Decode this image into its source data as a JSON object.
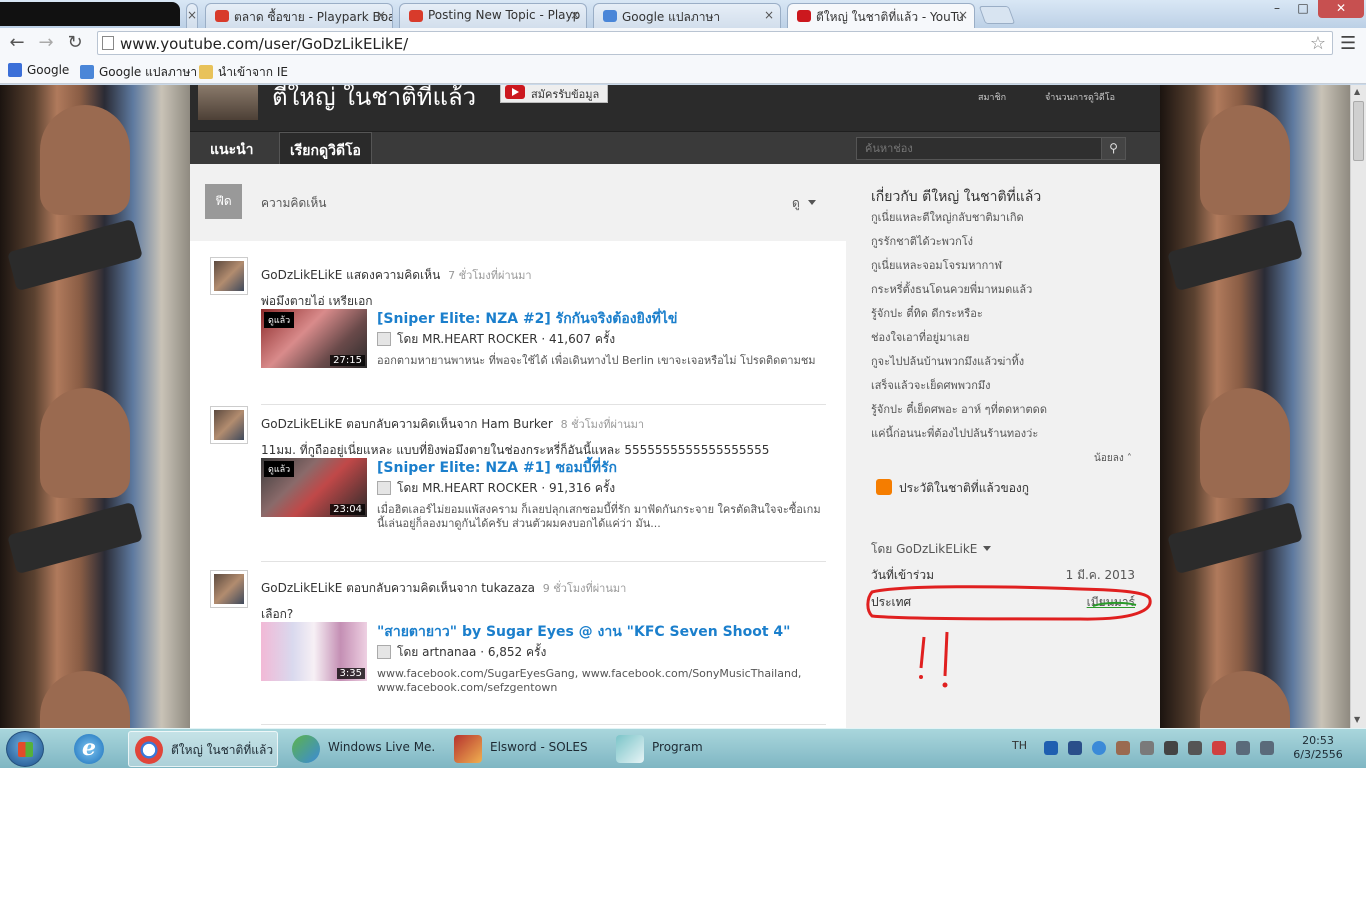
{
  "browser": {
    "tabs": [
      {
        "label": "ตลาด ซื้อขาย - Playpark Boa",
        "favicon_color": "#d83b2b"
      },
      {
        "label": "Posting New Topic - Playp",
        "favicon_color": "#d83b2b"
      },
      {
        "label": "Google แปลภาษา",
        "favicon_color": "#4a86d8"
      },
      {
        "label": "ตีใหญ่ ในชาติที่แล้ว - YouTu",
        "favicon_color": "#cc181e"
      }
    ],
    "tab_close_glyph": "×",
    "window_controls": {
      "minimize": "–",
      "maximize": "□",
      "close": "✕"
    },
    "url": "www.youtube.com/user/GoDzLikELikE/",
    "bookmarks": [
      {
        "label": "Google",
        "icon": "google-icon",
        "color": "#3b6fd8"
      },
      {
        "label": "Google แปลภาษา",
        "icon": "translate-icon",
        "color": "#4a86d8"
      },
      {
        "label": "นำเข้าจาก IE",
        "icon": "folder-icon",
        "color": "#e8c25a"
      }
    ]
  },
  "channel": {
    "title": "ตีใหญ่ ในชาติที่แล้ว",
    "subscribe_label": "สมัครรับข้อมูล",
    "stats": {
      "subscribers_label": "สมาชิก",
      "views_label": "จำนวนการดูวิดีโอ"
    },
    "tabs": [
      {
        "label": "แนะนำ"
      },
      {
        "label": "เรียกดูวิดีโอ"
      }
    ],
    "search_placeholder": "ค้นหาช่อง"
  },
  "feed": {
    "header_badge": "ฟีด",
    "filter_label": "ความคิดเห็น",
    "view_label": "ดู",
    "items": [
      {
        "actor": "GoDzLikELikE",
        "action": "แสดงความคิดเห็น",
        "time": "7 ชั่วโมงที่ผ่านมา",
        "comment": "พ่อมึงตายไอ่ เหรียเอก",
        "video_title": "[Sniper Elite: NZA #2] รักกันจริงต้องยิงที่ไข่",
        "by_prefix": "โดย",
        "uploader": "MR.HEART ROCKER",
        "views": "41,607 ครั้ง",
        "thumb_badge": "ดูแล้ว",
        "duration": "27:15",
        "description": "ออกตามหายานพาหนะ ที่พอจะใช้ได้ เพื่อเดินทางไป Berlin เขาจะเจอหรือไม่ โปรดติดตามชม"
      },
      {
        "actor": "GoDzLikELikE",
        "action": "ตอบกลับความคิดเห็นจาก Ham Burker",
        "time": "8 ชั่วโมงที่ผ่านมา",
        "comment": "11มม. ที่กูถืออยู่เนี่ยแหละ แบบที่ยิงพ่อมึงตายในช่องกระหรี่ก็อันนี้แหละ 5555555555555555555",
        "video_title": "[Sniper Elite: NZA #1] ซอมบี้ที่รัก",
        "by_prefix": "โดย",
        "uploader": "MR.HEART ROCKER",
        "views": "91,316 ครั้ง",
        "thumb_badge": "ดูแล้ว",
        "duration": "23:04",
        "description": "เมื่อฮิตเลอร์ไม่ยอมแพ้สงคราม ก็เลยปลุกเสกซอมบี้ที่รัก มาฟัดกันกระจาย ใครตัดสินใจจะซื้อเกมนี้เล่นอยู่ก็ลองมาดูกันได้ครับ ส่วนตัวผมคงบอกได้แค่ว่า มัน..."
      },
      {
        "actor": "GoDzLikELikE",
        "action": "ตอบกลับความคิดเห็นจาก tukazaza",
        "time": "9 ชั่วโมงที่ผ่านมา",
        "comment": "เลือก?",
        "video_title": "\"สายตายาว\" by Sugar Eyes @ งาน \"KFC Seven Shoot 4\"",
        "by_prefix": "โดย",
        "uploader": "artnanaa",
        "views": "6,852 ครั้ง",
        "thumb_badge": "",
        "duration": "3:35",
        "description": "www.facebook.com/SugarEyesGang, www.facebook.com/SonyMusicThailand, www.facebook.com/sefzgentown"
      }
    ]
  },
  "sidebar": {
    "about_title": "เกี่ยวกับ ตีใหญ่ ในชาติที่แล้ว",
    "about_lines": [
      "กูเนี่ยแหละตีใหญ่กลับชาติมาเกิด",
      "กูรรักชาติได้วะพวกโง่",
      "กูเนี่ยแหละจอมโจรมหากาฬ",
      "กระหรี่ตั้งธนโดนควยพี่มาหมดแล้ว",
      "รู้จักปะ ตี๋ทิด ดีกระหรือะ",
      "ช่องใจเอาที่อยู่มาเลย",
      "กูจะไปปล้นบ้านพวกมึงแล้วฆ่าทิ้ง",
      "เสร็จแล้วจะเย็ดศพพวกมึง",
      "รู้จักปะ ตี๋เย็ดศพอะ อาห์ ๆที่ตดหาตดด",
      "แค่นี้ก่อนนะพี่ต้องไปปล้นร้านทองว่ะ"
    ],
    "less_label": "น้อยลง",
    "blog_label": "ประวัติในชาติที่แล้วของกู",
    "by_user_label": "โดย GoDzLikELikE",
    "joined_label": "วันที่เข้าร่วม",
    "joined_value": "1 มี.ค. 2013",
    "country_label": "ประเทศ",
    "country_value": "เมียนมาร์"
  },
  "taskbar": {
    "apps": [
      {
        "label": "ตีใหญ่ ในชาติที่แล้ว ...",
        "icon": "chrome-icon",
        "color": "#e0453a"
      },
      {
        "label": "Windows Live Me...",
        "icon": "messenger-icon",
        "color": "#5db34b"
      },
      {
        "label": "Elsword - SOLES",
        "icon": "elsword-icon",
        "color": "#b5322e"
      },
      {
        "label": "Program",
        "icon": "program-icon",
        "color": "#7ac4c8"
      }
    ],
    "language": "TH",
    "time": "20:53",
    "date": "6/3/2556"
  },
  "colors": {
    "annotation": "#e02020",
    "underline": "#2a9a2a",
    "link": "#1b7fcc"
  }
}
